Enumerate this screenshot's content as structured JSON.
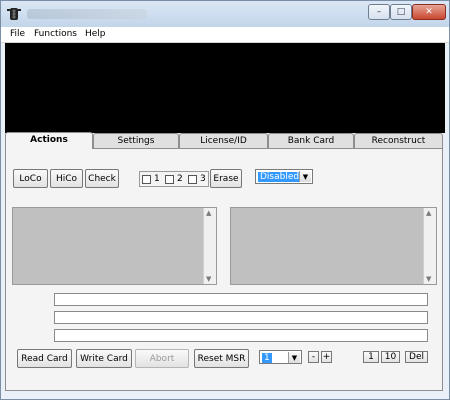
{
  "window": {
    "title_blurred": true
  },
  "titlebar": {
    "minimize": "–",
    "maximize": "□",
    "close": "✕"
  },
  "menu": {
    "file": "File",
    "functions": "Functions",
    "help": "Help"
  },
  "tabs": [
    "Actions",
    "Settings",
    "License/ID",
    "Bank Card",
    "Reconstruct"
  ],
  "actions": {
    "loco": "LoCo",
    "hico": "HiCo",
    "check": "Check",
    "tracks": [
      "1",
      "2",
      "3"
    ],
    "erase": "Erase",
    "erase_mode": "Disabled",
    "read_card": "Read Card",
    "write_card": "Write Card",
    "abort": "Abort",
    "reset_msr": "Reset MSR",
    "count_value": "1",
    "minus": "-",
    "plus": "+",
    "one": "1",
    "ten": "10",
    "del": "Del"
  },
  "icons": {
    "app": "traffic-light-icon"
  }
}
